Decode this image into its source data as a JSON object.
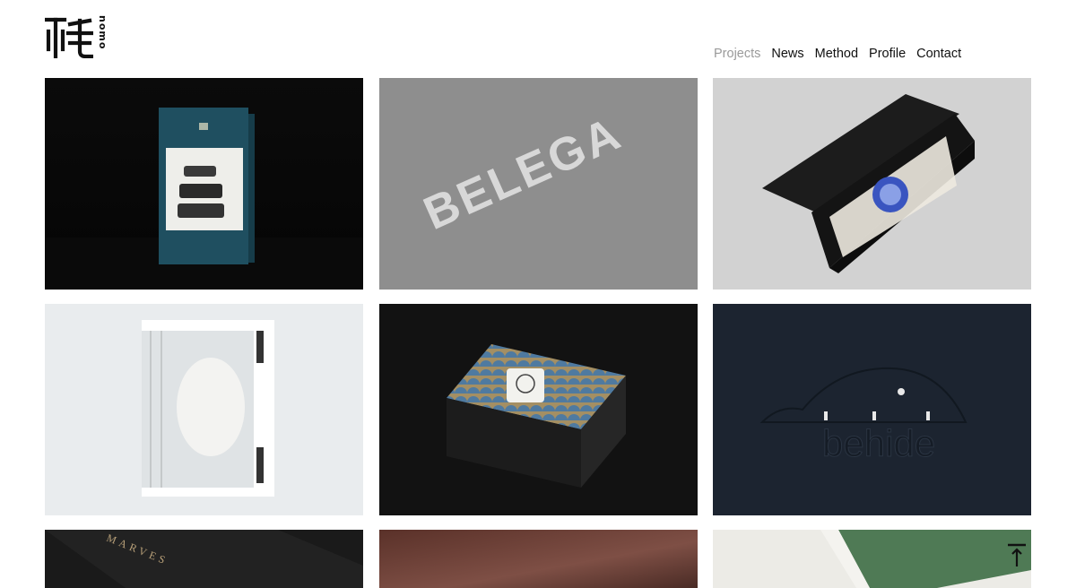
{
  "brand": {
    "logo_name": "nomo",
    "logo_glyph": "nomo-logo-icon"
  },
  "nav": {
    "items": [
      {
        "label": "Projects",
        "active": true
      },
      {
        "label": "News",
        "active": false
      },
      {
        "label": "Method",
        "active": false
      },
      {
        "label": "Profile",
        "active": false
      },
      {
        "label": "Contact",
        "active": false
      }
    ]
  },
  "projects": {
    "tiles": [
      {
        "name": "teal-tea-box",
        "text": ""
      },
      {
        "name": "belega-emboss",
        "text": "BELEGA"
      },
      {
        "name": "wine-box",
        "text": ""
      },
      {
        "name": "white-poster",
        "text": ""
      },
      {
        "name": "patterned-box",
        "text": ""
      },
      {
        "name": "behide-emboss",
        "text": "behide"
      },
      {
        "name": "black-box-marves",
        "text": "MARVES"
      },
      {
        "name": "brown-surface",
        "text": ""
      },
      {
        "name": "green-box",
        "text": ""
      }
    ]
  },
  "colors": {
    "nav_active": "#9a9a9a",
    "nav_default": "#111111"
  },
  "back_to_top_icon": "arrow-up-to-line-icon"
}
